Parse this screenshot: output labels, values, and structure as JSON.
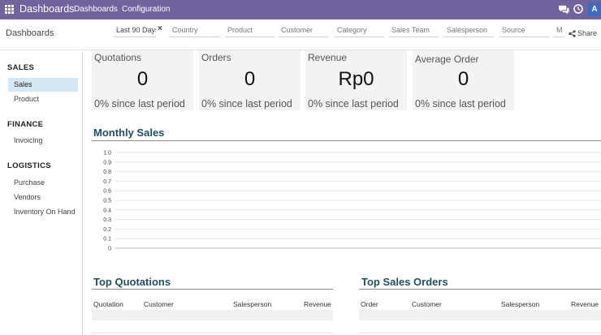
{
  "navbar": {
    "app_title": "Dashboards",
    "menus": [
      "Dashboards",
      "Configuration"
    ],
    "avatar_initial": "A",
    "color": "#71639e"
  },
  "control_panel": {
    "breadcrumb": "Dashboards",
    "filters": [
      {
        "label": "Last 90 Days",
        "type": "date"
      },
      {
        "label": "Country",
        "type": "text"
      },
      {
        "label": "Product",
        "type": "text"
      },
      {
        "label": "Customer",
        "type": "text"
      },
      {
        "label": "Category",
        "type": "text"
      },
      {
        "label": "Sales Team",
        "type": "text"
      },
      {
        "label": "Salesperson",
        "type": "text"
      },
      {
        "label": "Source",
        "type": "text"
      },
      {
        "label": "M",
        "type": "text"
      }
    ],
    "clear_icon": "×",
    "share_label": "Share"
  },
  "sidebar": {
    "sections": [
      {
        "title": "SALES",
        "items": [
          {
            "label": "Sales",
            "active": true
          },
          {
            "label": "Product",
            "active": false
          }
        ]
      },
      {
        "title": "FINANCE",
        "items": [
          {
            "label": "Invoicing",
            "active": false
          }
        ]
      },
      {
        "title": "LOGISTICS",
        "items": [
          {
            "label": "Purchase",
            "active": false
          },
          {
            "label": "Vendors",
            "active": false
          },
          {
            "label": "Inventory On Hand",
            "active": false
          }
        ]
      }
    ]
  },
  "kpis": [
    {
      "title": "Quotations",
      "value": "0",
      "delta": "0% since last period"
    },
    {
      "title": "Orders",
      "value": "0",
      "delta": "0% since last period"
    },
    {
      "title": "Revenue",
      "value": "Rp0",
      "delta": "0% since last period"
    },
    {
      "title": "Average Order",
      "value": "0",
      "delta": "0% since last period"
    }
  ],
  "monthly_sales": {
    "title": "Monthly Sales",
    "chart_data": {
      "type": "line",
      "title": "",
      "xlabel": "",
      "ylabel": "",
      "x": [],
      "series": [],
      "yticks": [
        "0",
        "0.1",
        "0.2",
        "0.3",
        "0.4",
        "0.5",
        "0.6",
        "0.7",
        "0.8",
        "0.9",
        "1.0"
      ],
      "ylim": [
        0,
        1
      ],
      "grid": true
    }
  },
  "top_quotations": {
    "title": "Top Quotations",
    "columns": [
      "Quotation",
      "Customer",
      "Salesperson",
      "Revenue"
    ]
  },
  "top_sales_orders": {
    "title": "Top Sales Orders",
    "columns": [
      "Order",
      "Customer",
      "Salesperson",
      "Revenue"
    ]
  }
}
